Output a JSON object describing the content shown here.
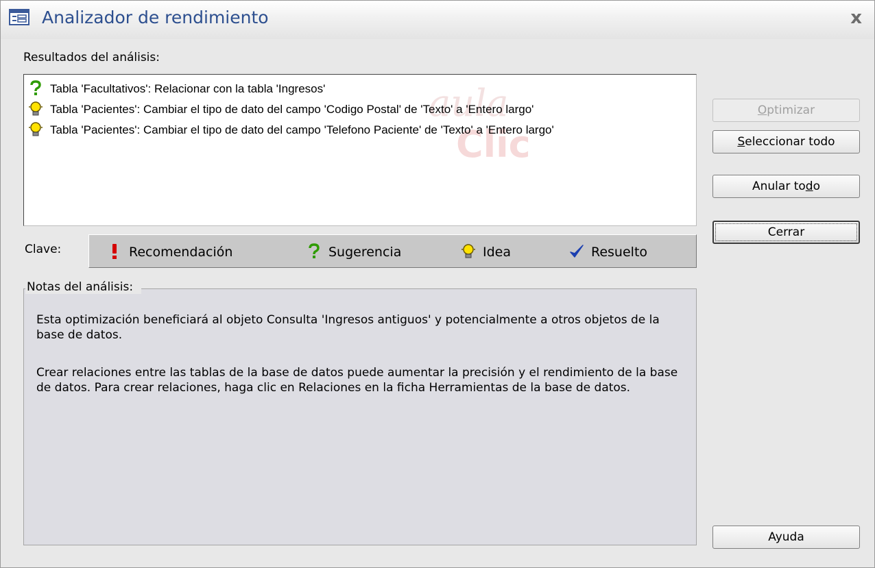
{
  "window": {
    "title": "Analizador de rendimiento",
    "close_glyph": "x",
    "icon": "form-window-icon"
  },
  "results": {
    "label": "Resultados del análisis:",
    "items": [
      {
        "type": "sugerencia",
        "icon": "question-icon",
        "text": "Tabla 'Facultativos': Relacionar con la tabla 'Ingresos'"
      },
      {
        "type": "idea",
        "icon": "lightbulb-icon",
        "text": "Tabla 'Pacientes': Cambiar el tipo de dato del campo 'Codigo Postal' de 'Texto' a 'Entero largo'"
      },
      {
        "type": "idea",
        "icon": "lightbulb-icon",
        "text": "Tabla 'Pacientes': Cambiar el tipo de dato del campo 'Telefono Paciente' de 'Texto' a 'Entero largo'"
      }
    ],
    "watermark_top": "aula",
    "watermark_bottom": "Clic"
  },
  "legend": {
    "label": "Clave:",
    "items": [
      {
        "icon": "exclamation-icon",
        "label": "Recomendación",
        "color": "#d40000"
      },
      {
        "icon": "question-icon",
        "label": "Sugerencia",
        "color": "#2e9b00"
      },
      {
        "icon": "lightbulb-icon",
        "label": "Idea",
        "color": "#e0c000"
      },
      {
        "icon": "checkmark-icon",
        "label": "Resuelto",
        "color": "#1b3fb0"
      }
    ]
  },
  "notes": {
    "label": "Notas del análisis:",
    "paragraphs": [
      "Esta optimización beneficiará al objeto Consulta 'Ingresos antiguos' y potencialmente a otros objetos de la base de datos.",
      "Crear relaciones entre las tablas de la base de datos puede aumentar la precisión y el rendimiento de la base de datos. Para crear relaciones, haga clic en Relaciones en la ficha Herramientas de la base de datos."
    ]
  },
  "buttons": {
    "optimize": {
      "pre": "",
      "accel": "O",
      "post": "ptimizar",
      "enabled": false
    },
    "select_all": {
      "pre": "",
      "accel": "S",
      "post": "eleccionar todo",
      "enabled": true
    },
    "deselect_all": {
      "pre": "Anular to",
      "accel": "d",
      "post": "o",
      "enabled": true
    },
    "close": {
      "label": "Cerrar",
      "enabled": true,
      "default": true
    },
    "help": {
      "label": "Ayuda",
      "enabled": true
    }
  },
  "colors": {
    "title_text": "#2d4f8f",
    "dialog_bg": "#e8e8e8",
    "legend_bg": "#c8c8c8"
  }
}
